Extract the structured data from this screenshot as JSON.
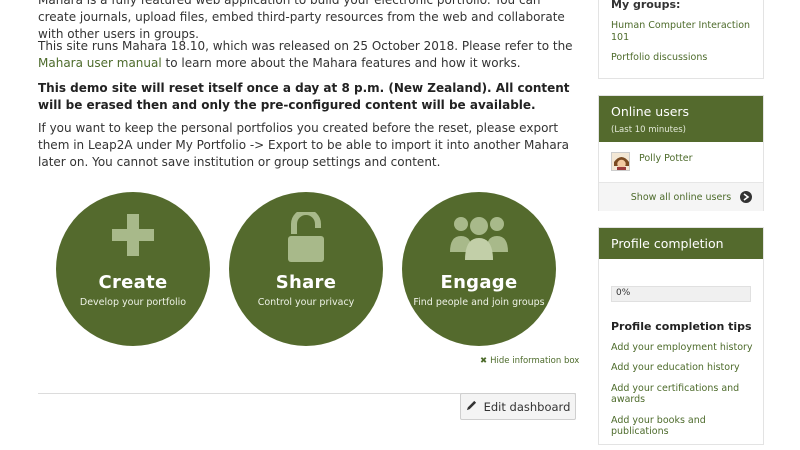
{
  "intro": {
    "p1": "Mahara is a fully featured web application to build your electronic portfolio. You can create journals, upload files, embed third-party resources from the web and collaborate with other users in groups.",
    "p2_pre": "This site runs Mahara 18.10, which was released on 25 October 2018. Please refer to the ",
    "p2_link": "Mahara user manual",
    "p2_post": " to learn more about the Mahara features and how it works.",
    "p3": "This demo site will reset itself once a day at 8 p.m. (New Zealand). All content will be erased then and only the pre-configured content will be available.",
    "p4": "If you want to keep the personal portfolios you created before the reset, please export them in Leap2A under My Portfolio -> Export to be able to import it into another Mahara later on. You cannot save institution or group settings and content."
  },
  "cards": [
    {
      "title": "Create",
      "subtitle": "Develop your portfolio",
      "icon": "plus-icon"
    },
    {
      "title": "Share",
      "subtitle": "Control your privacy",
      "icon": "unlock-icon"
    },
    {
      "title": "Engage",
      "subtitle": "Find people and join groups",
      "icon": "users-icon"
    }
  ],
  "hide_info": "Hide information box",
  "edit_dashboard": "Edit dashboard",
  "groups": {
    "heading": "My groups:",
    "items": [
      "Human Computer Interaction 101",
      "Portfolio discussions"
    ]
  },
  "online_users": {
    "title": "Online users",
    "subtitle": "(Last 10 minutes)",
    "users": [
      "Polly Potter"
    ],
    "show_all": "Show all online users"
  },
  "profile_completion": {
    "title": "Profile completion",
    "percent": 0,
    "percent_label": "0%",
    "tips_heading": "Profile completion tips",
    "tips": [
      "Add your employment history",
      "Add your education history",
      "Add your certifications and awards",
      "Add your books and publications"
    ]
  },
  "colors": {
    "accent": "#546a2d",
    "link": "#4d6b2b"
  }
}
